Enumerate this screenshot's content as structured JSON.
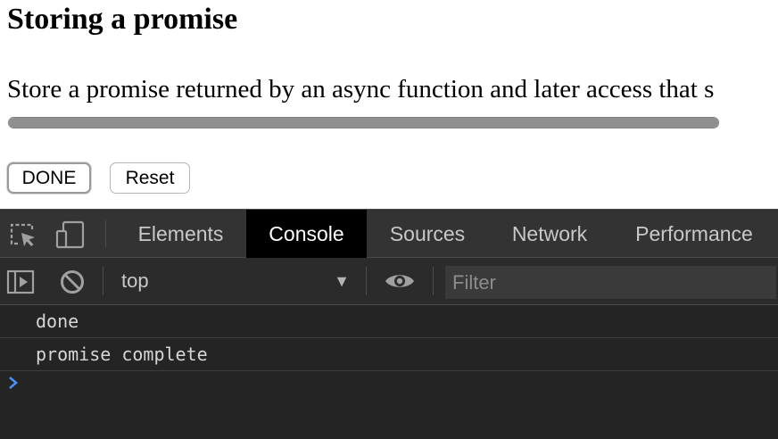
{
  "page": {
    "title": "Storing a promise",
    "description": "Store a promise returned by an async function and later access that s",
    "progress": 1.0,
    "buttons": {
      "done": "DONE",
      "reset": "Reset"
    }
  },
  "devtools": {
    "tabs": [
      {
        "label": "Elements",
        "active": false
      },
      {
        "label": "Console",
        "active": true
      },
      {
        "label": "Sources",
        "active": false
      },
      {
        "label": "Network",
        "active": false
      },
      {
        "label": "Performance",
        "active": false
      }
    ],
    "toolbar": {
      "context": "top",
      "filter_placeholder": "Filter"
    },
    "console_lines": [
      "done",
      "promise complete"
    ],
    "colors": {
      "prompt": "#4c8cf5",
      "active_tab_bg": "#000000"
    }
  }
}
